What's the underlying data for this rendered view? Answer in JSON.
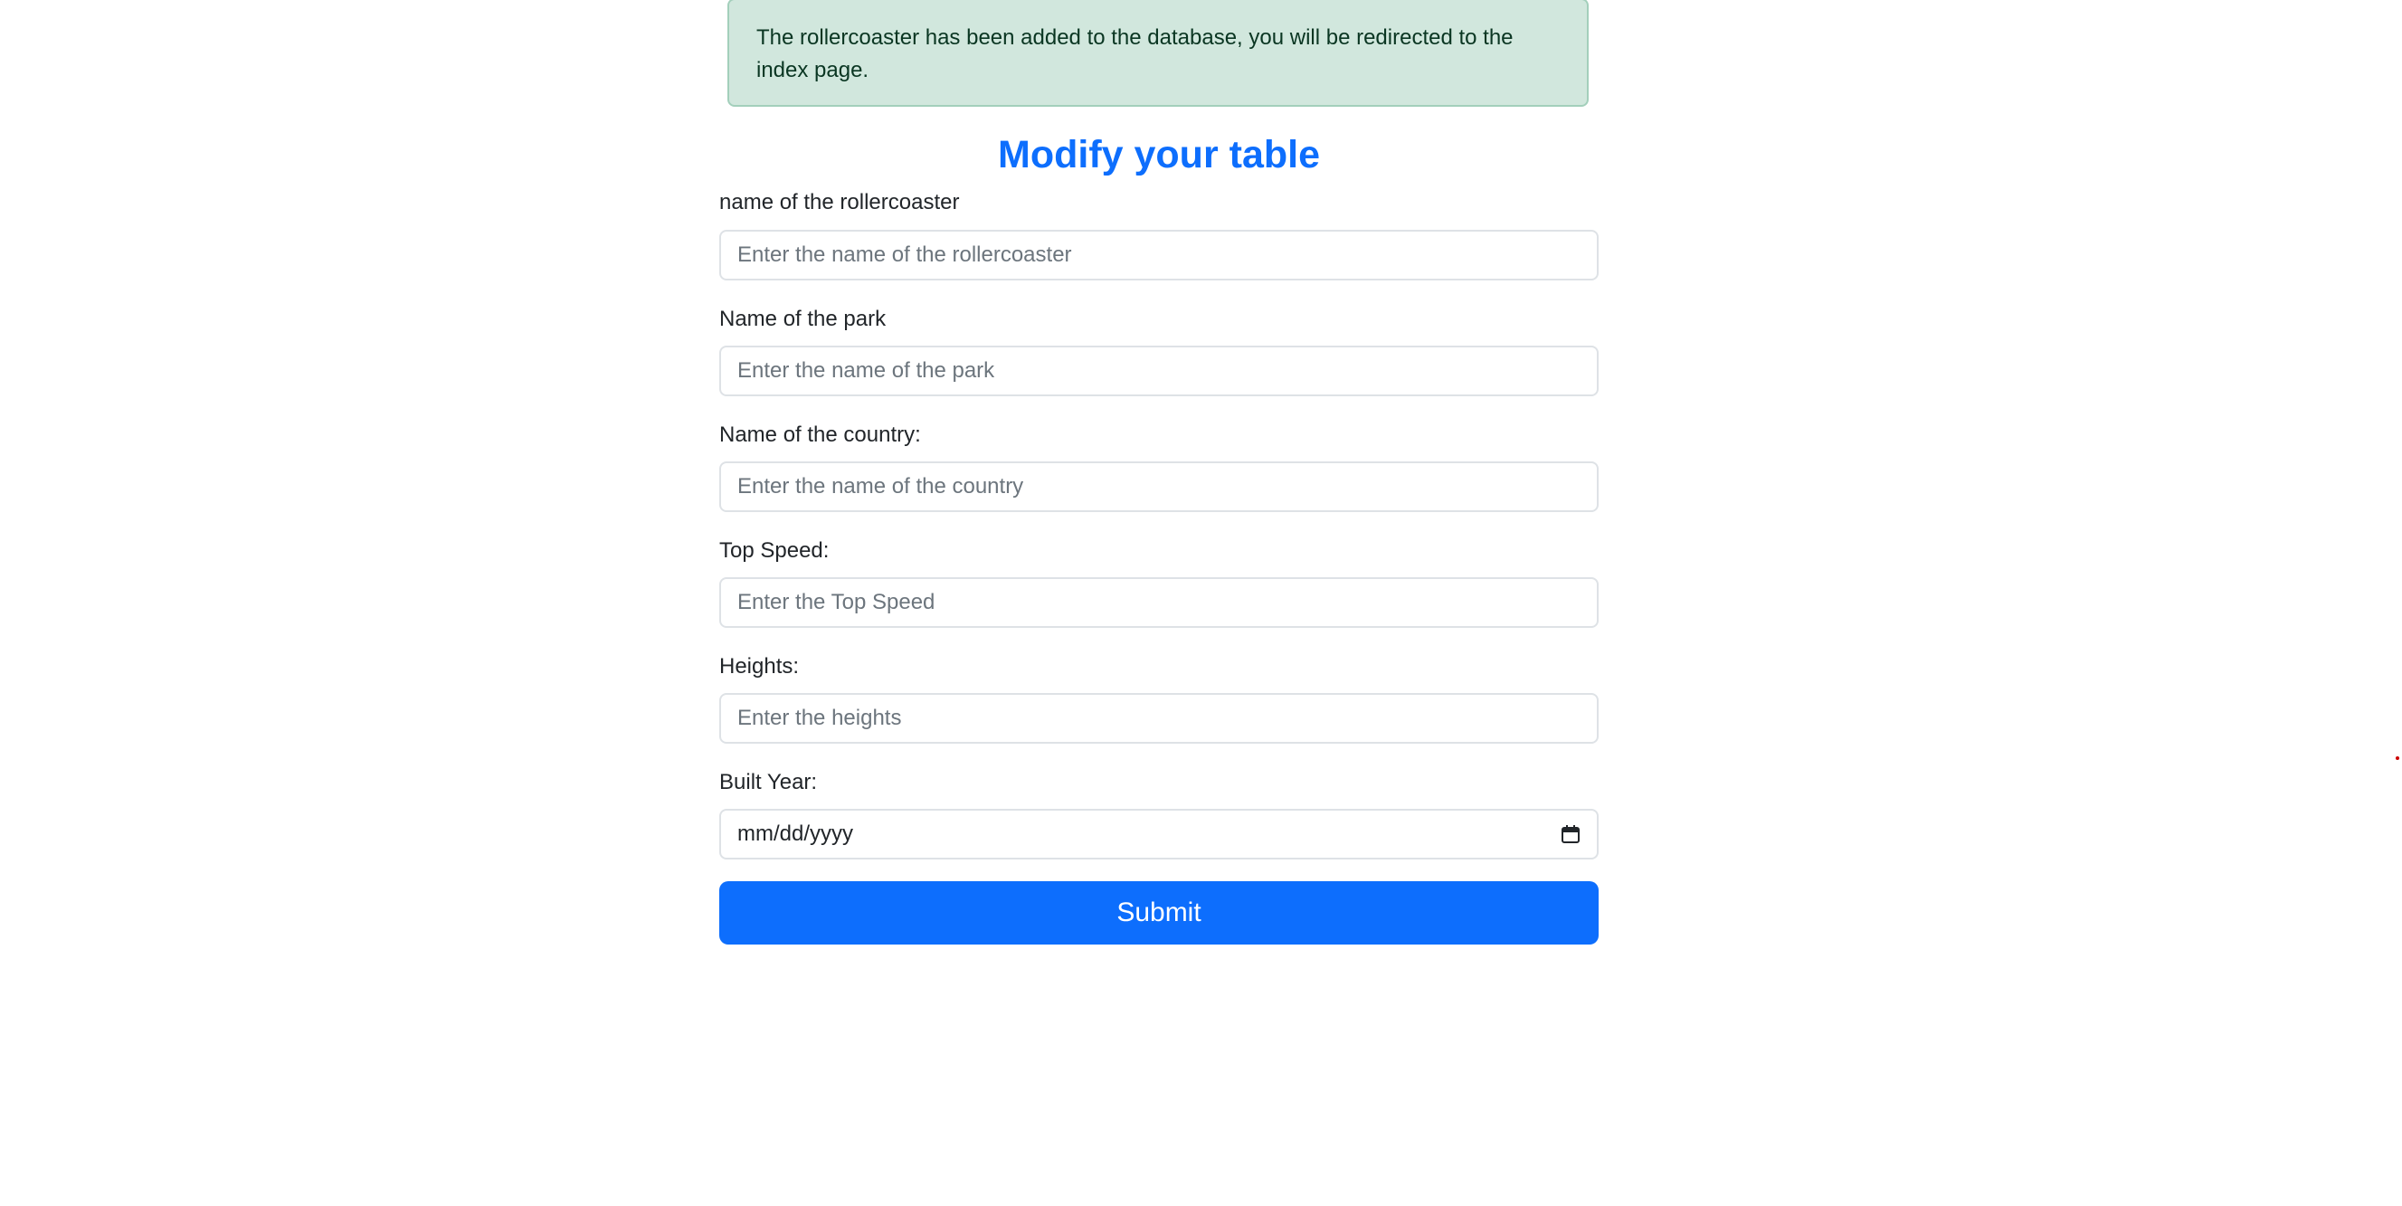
{
  "alert": {
    "message": "The rollercoaster has been added to the database, you will be redirected to the index page."
  },
  "form": {
    "title": "Modify your table",
    "fields": [
      {
        "label": "name of the rollercoaster",
        "placeholder": "Enter the name of the rollercoaster",
        "value": ""
      },
      {
        "label": "Name of the park",
        "placeholder": "Enter the name of the park",
        "value": ""
      },
      {
        "label": "Name of the country:",
        "placeholder": "Enter the name of the country",
        "value": ""
      },
      {
        "label": "Top Speed:",
        "placeholder": "Enter the Top Speed",
        "value": ""
      },
      {
        "label": "Heights:",
        "placeholder": "Enter the heights",
        "value": ""
      }
    ],
    "built_year": {
      "label": "Built Year:",
      "value": "mm/dd/yyyy",
      "icon": "calendar-icon"
    },
    "submit_label": "Submit"
  },
  "colors": {
    "primary": "#0d6efd",
    "alert_bg": "#d1e7dd",
    "alert_border": "#a3cfbb",
    "alert_text": "#0a3622"
  }
}
